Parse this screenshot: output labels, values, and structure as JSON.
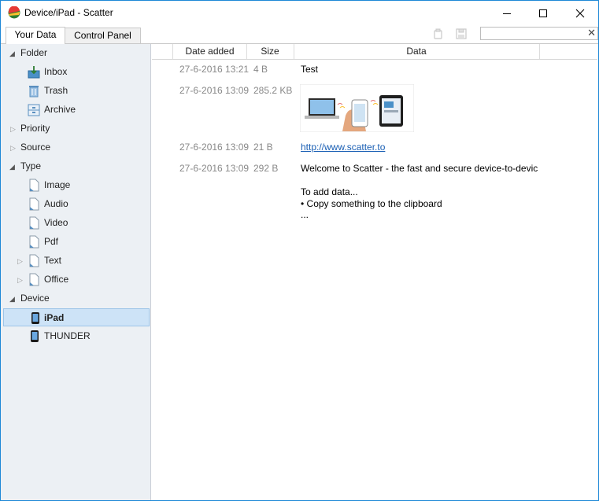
{
  "window": {
    "title": "Device/iPad - Scatter"
  },
  "tabs": [
    {
      "label": "Your Data",
      "active": true
    },
    {
      "label": "Control Panel",
      "active": false
    }
  ],
  "search": {
    "value": "",
    "clear_label": "✕"
  },
  "sidebar": {
    "items": [
      {
        "label": "Folder",
        "level": 0,
        "arrow": "expanded"
      },
      {
        "label": "Inbox",
        "level": 1,
        "icon": "inbox-icon"
      },
      {
        "label": "Trash",
        "level": 1,
        "icon": "trash-icon"
      },
      {
        "label": "Archive",
        "level": 1,
        "icon": "archive-icon"
      },
      {
        "label": "Priority",
        "level": 0,
        "arrow": "collapsed"
      },
      {
        "label": "Source",
        "level": 0,
        "arrow": "collapsed"
      },
      {
        "label": "Type",
        "level": 0,
        "arrow": "expanded"
      },
      {
        "label": "Image",
        "level": 1,
        "icon": "file-icon"
      },
      {
        "label": "Audio",
        "level": 1,
        "icon": "file-icon"
      },
      {
        "label": "Video",
        "level": 1,
        "icon": "file-icon"
      },
      {
        "label": "Pdf",
        "level": 1,
        "icon": "file-icon"
      },
      {
        "label": "Text",
        "level": 1,
        "icon": "file-icon",
        "arrow": "collapsed"
      },
      {
        "label": "Office",
        "level": 1,
        "icon": "file-icon",
        "arrow": "collapsed"
      },
      {
        "label": "Device",
        "level": 0,
        "arrow": "expanded"
      },
      {
        "label": "iPad",
        "level": 1,
        "icon": "phone-icon",
        "selected": true
      },
      {
        "label": "THUNDER",
        "level": 1,
        "icon": "phone-icon"
      }
    ]
  },
  "table": {
    "columns": [
      "Date added",
      "Size",
      "Data"
    ],
    "rows": [
      {
        "date": "27-6-2016 13:21",
        "size": "4 B",
        "data": "Test",
        "kind": "text"
      },
      {
        "date": "27-6-2016 13:09",
        "size": "285.2 KB",
        "data": "",
        "kind": "image"
      },
      {
        "date": "27-6-2016 13:09",
        "size": "21 B",
        "data": "http://www.scatter.to",
        "kind": "link"
      },
      {
        "date": "27-6-2016 13:09",
        "size": "292 B",
        "kind": "multiline",
        "lines": [
          "Welcome to Scatter - the fast and secure device-to-devic",
          "",
          "To add data...",
          "• Copy something to the clipboard",
          "..."
        ]
      }
    ]
  },
  "colors": {
    "accent": "#1e88d6",
    "sidebar_bg": "#ecf0f4",
    "selection": "#cde3f7",
    "link": "#1a5fb4"
  }
}
